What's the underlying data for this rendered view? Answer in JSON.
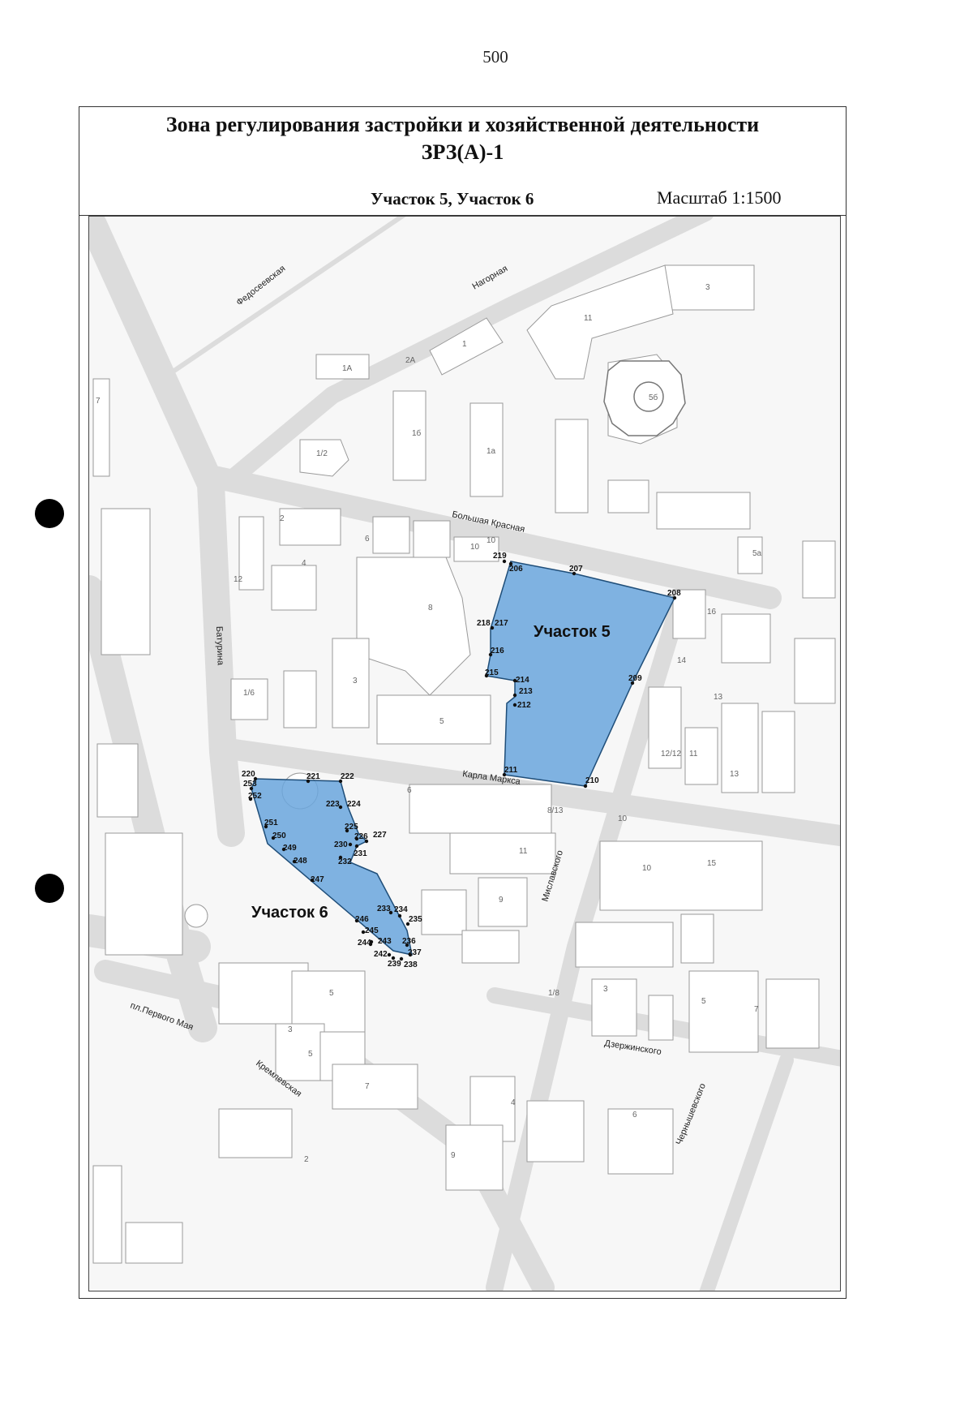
{
  "page": {
    "number": "500"
  },
  "header": {
    "title": "Зона регулирования застройки и хозяйственной деятельности",
    "zone_code": "ЗРЗ(А)-1",
    "sections": "Участок 5, Участок 6",
    "scale": "Масштаб 1:1500"
  },
  "map": {
    "plots": [
      {
        "name": "Участок 5",
        "color": "#6aa6dd"
      },
      {
        "name": "Участок 6",
        "color": "#6aa6dd"
      }
    ],
    "streets": [
      "Федосеевская",
      "Нагорная",
      "Большая Красная",
      "Батурина",
      "Карла Маркса",
      "Миславского",
      "пл.Первого Мая",
      "Кремлевская",
      "Дзержинского",
      "Чернышевского"
    ],
    "building_numbers": [
      "3",
      "11",
      "1А",
      "2А",
      "1",
      "5б",
      "1б",
      "1а",
      "1/2",
      "7",
      "2",
      "4",
      "6",
      "10",
      "12",
      "8",
      "3",
      "1/6",
      "5",
      "14",
      "16",
      "15",
      "13",
      "12/12",
      "11",
      "13",
      "6",
      "8/13",
      "11",
      "10",
      "10",
      "9",
      "5",
      "1/8",
      "3",
      "5",
      "7",
      "3",
      "5",
      "7",
      "9",
      "4",
      "2",
      "6",
      "5а",
      "10"
    ],
    "points_plot5": [
      "219",
      "206",
      "207",
      "208",
      "218",
      "217",
      "216",
      "215",
      "214",
      "213",
      "212",
      "209",
      "211",
      "210"
    ],
    "points_plot6": [
      "220",
      "253",
      "252",
      "221",
      "222",
      "223",
      "224",
      "225",
      "226",
      "227",
      "230",
      "231",
      "232",
      "251",
      "250",
      "249",
      "248",
      "247",
      "233",
      "234",
      "235",
      "246",
      "245",
      "243",
      "244",
      "236",
      "237",
      "242",
      "239",
      "238"
    ]
  }
}
